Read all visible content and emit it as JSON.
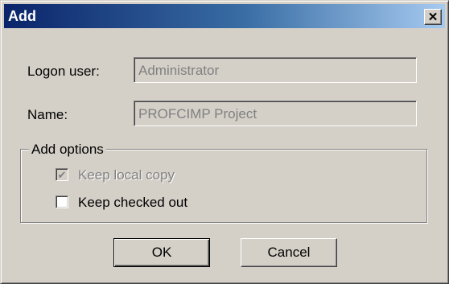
{
  "window": {
    "title": "Add",
    "close_glyph": "✕",
    "close_icon": "close-icon"
  },
  "form": {
    "logon_user_label": "Logon user:",
    "logon_user_value": "Administrator",
    "name_label": "Name:",
    "name_value": "PROFCIMP Project"
  },
  "options": {
    "group_label": "Add options",
    "keep_local_copy": {
      "label": "Keep local copy",
      "checked": true,
      "enabled": false
    },
    "keep_checked_out": {
      "label": "Keep checked out",
      "checked": false,
      "enabled": true
    },
    "check_glyph": "✔"
  },
  "buttons": {
    "ok_label": "OK",
    "cancel_label": "Cancel"
  },
  "colors": {
    "title_gradient_start": "#0a246a",
    "title_gradient_end": "#a6caf0",
    "dialog_face": "#d4d0c8",
    "disabled_text": "#808080"
  }
}
